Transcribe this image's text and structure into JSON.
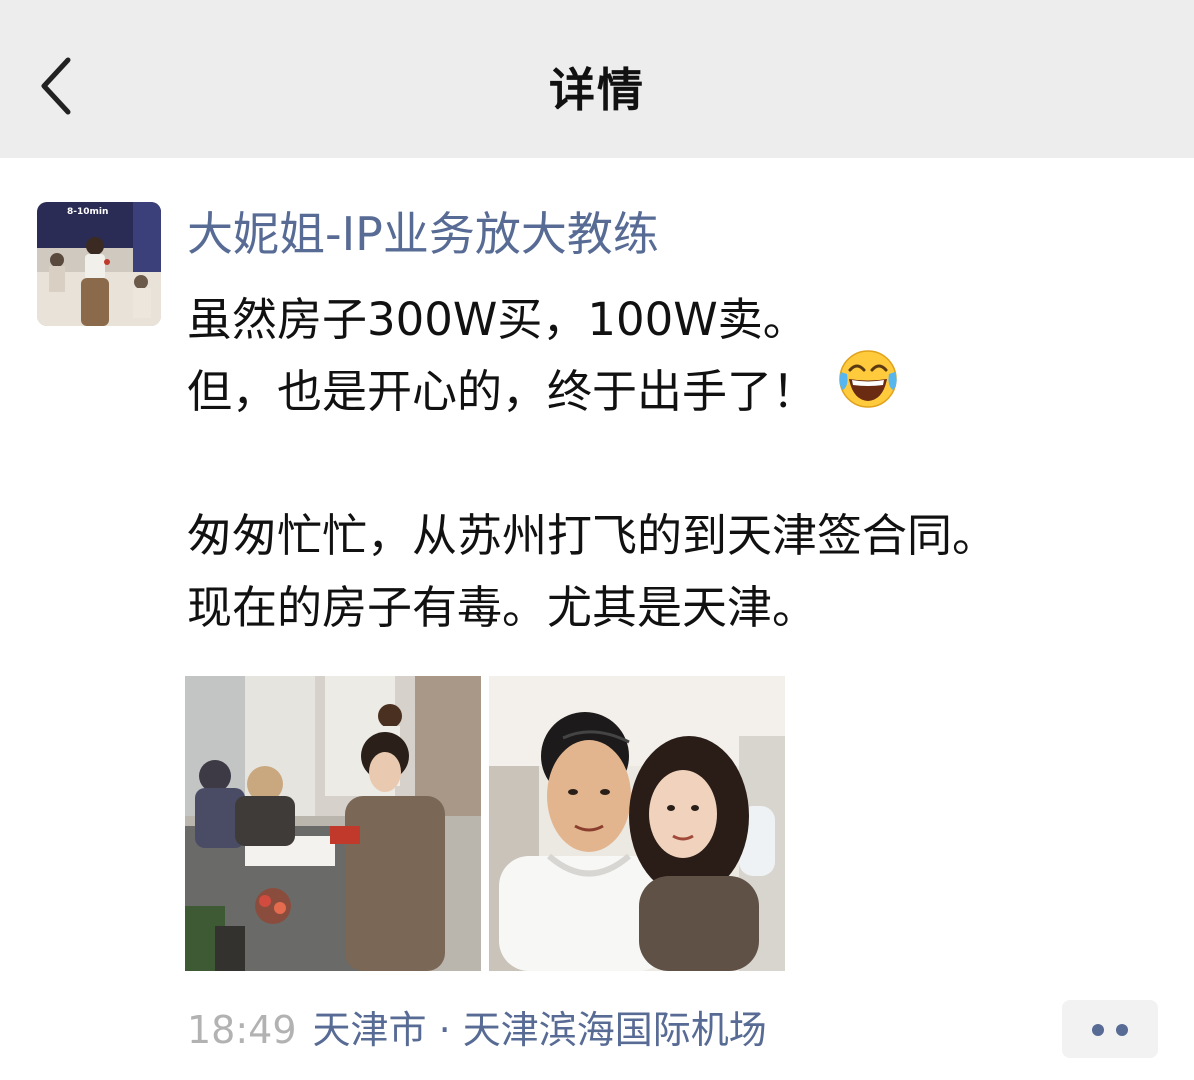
{
  "header": {
    "title": "详情",
    "back_icon": "chevron-left-icon"
  },
  "post": {
    "author": "大妮姐-IP业务放大教练",
    "avatar_badge_text": "8-10min",
    "lines": [
      "虽然房子300W买，100W卖。",
      "但，也是开心的，终于出手了！",
      "",
      "匆匆忙忙，从苏州打飞的到天津签合同。",
      "现在的房子有毒。尤其是天津。"
    ],
    "emoji": "tears-of-joy-emoji",
    "images": [
      "photo-group-signing-contract",
      "photo-selfie-couple-on-plane"
    ],
    "time": "18:49",
    "location": "天津市 · 天津滨海国际机场",
    "more_icon": "more-dots-icon"
  },
  "colors": {
    "header_bg": "#ededed",
    "link_blue": "#576b95",
    "text": "#111111",
    "time_gray": "#b2b2b2"
  }
}
